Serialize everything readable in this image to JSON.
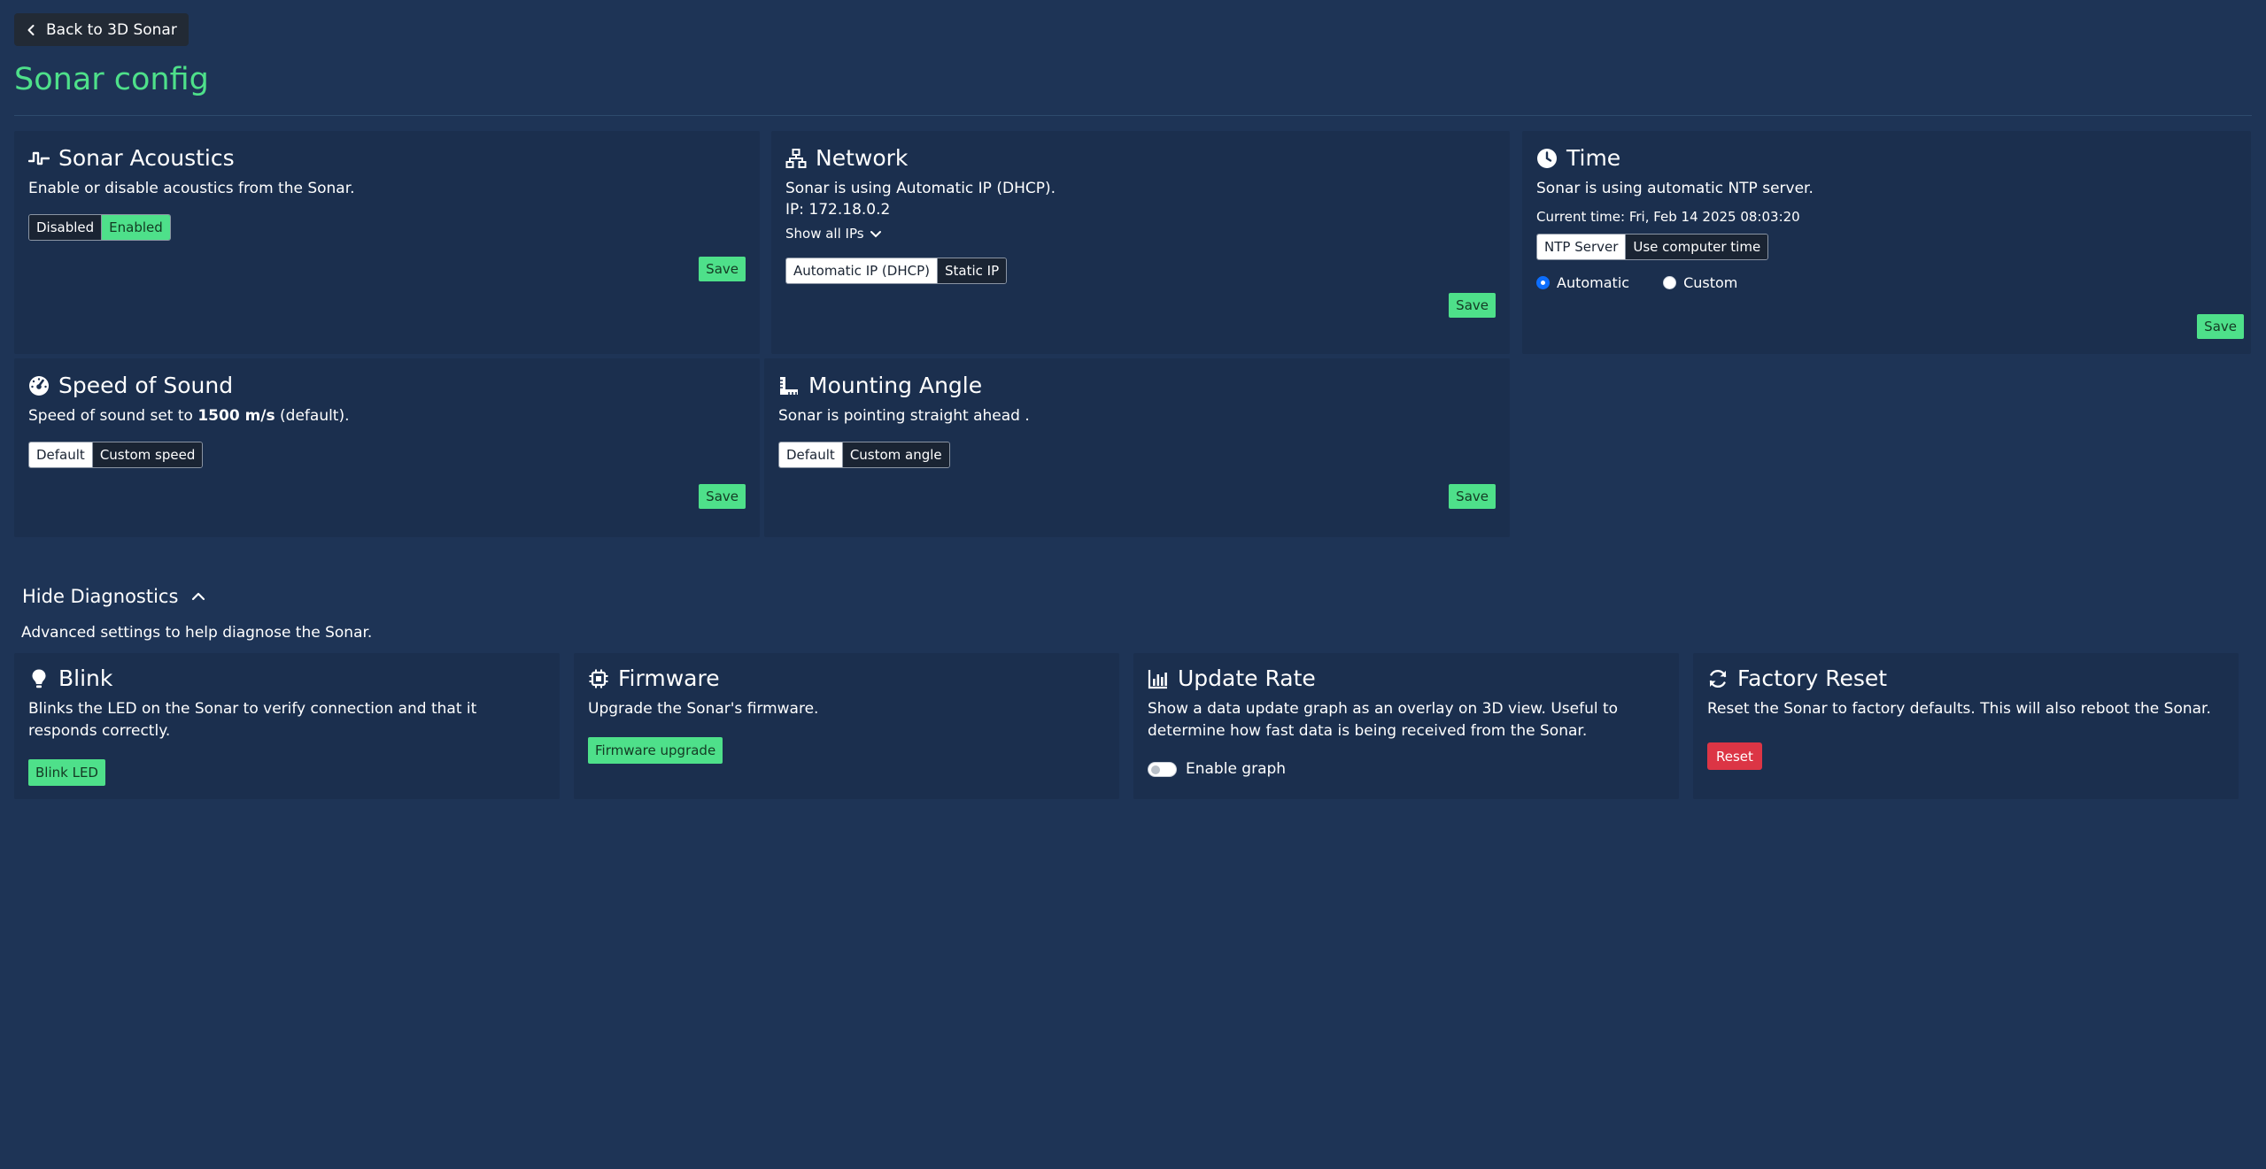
{
  "header": {
    "back_label": "Back to 3D Sonar",
    "title": "Sonar config"
  },
  "acoustics": {
    "title": "Sonar Acoustics",
    "desc": "Enable or disable acoustics from the Sonar.",
    "options": [
      "Disabled",
      "Enabled"
    ],
    "selected": "Enabled",
    "save": "Save"
  },
  "network": {
    "title": "Network",
    "desc": "Sonar is using Automatic IP (DHCP).",
    "ip": "IP: 172.18.0.2",
    "show_ips": "Show all IPs",
    "options": [
      "Automatic IP (DHCP)",
      "Static IP"
    ],
    "selected": "Automatic IP (DHCP)",
    "save": "Save"
  },
  "time": {
    "title": "Time",
    "desc": "Sonar is using automatic NTP server.",
    "current": "Current time: Fri, Feb 14 2025 08:03:20",
    "options": [
      "NTP Server",
      "Use computer time"
    ],
    "selected": "NTP Server",
    "radio_options": [
      "Automatic",
      "Custom"
    ],
    "radio_selected": "Automatic",
    "save": "Save"
  },
  "speed": {
    "title": "Speed of Sound",
    "desc_prefix": "Speed of sound set to ",
    "desc_value": "1500 m/s",
    "desc_suffix": " (default).",
    "options": [
      "Default",
      "Custom speed"
    ],
    "selected": "Default",
    "save": "Save"
  },
  "mounting": {
    "title": "Mounting Angle",
    "desc": "Sonar is pointing straight ahead .",
    "options": [
      "Default",
      "Custom angle"
    ],
    "selected": "Default",
    "save": "Save"
  },
  "diagnostics": {
    "toggle_label": "Hide Diagnostics",
    "subtitle": "Advanced settings to help diagnose the Sonar."
  },
  "blink": {
    "title": "Blink",
    "desc": "Blinks the LED on the Sonar to verify connection and that it responds correctly.",
    "button": "Blink LED"
  },
  "firmware": {
    "title": "Firmware",
    "desc": "Upgrade the Sonar's firmware.",
    "button": "Firmware upgrade"
  },
  "update_rate": {
    "title": "Update Rate",
    "desc": "Show a data update graph as an overlay on 3D view. Useful to determine how fast data is being received from the Sonar.",
    "toggle_label": "Enable graph",
    "enabled": false
  },
  "factory_reset": {
    "title": "Factory Reset",
    "desc": "Reset the Sonar to factory defaults. This will also reboot the Sonar.",
    "button": "Reset"
  },
  "colors": {
    "background": "#1e3456",
    "card": "#1b2f4e",
    "accent_green": "#4ee08a",
    "danger_red": "#dc3545"
  }
}
